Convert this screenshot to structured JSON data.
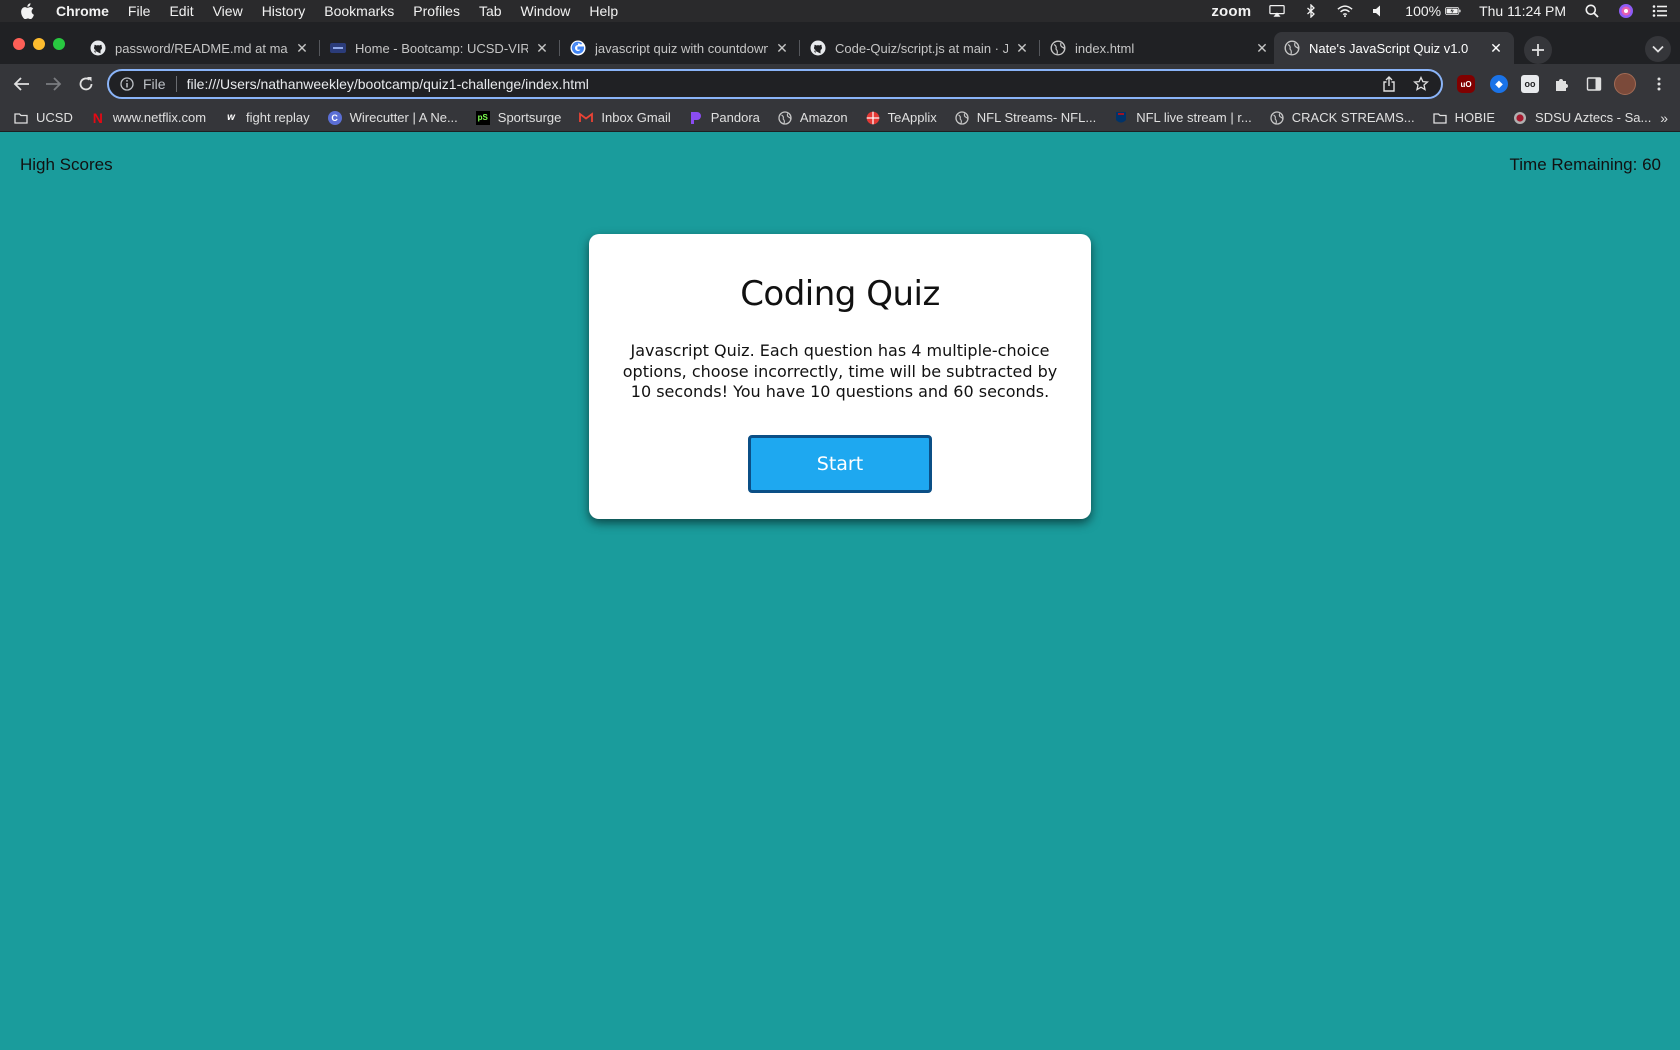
{
  "menubar": {
    "app_name": "Chrome",
    "menus": [
      "File",
      "Edit",
      "View",
      "History",
      "Bookmarks",
      "Profiles",
      "Tab",
      "Window",
      "Help"
    ],
    "zoom_label": "zoom",
    "battery": "100%",
    "clock": "Thu 11:24 PM"
  },
  "tabs": [
    {
      "title": "password/README.md at mast",
      "icon": "github-icon"
    },
    {
      "title": "Home - Bootcamp: UCSD-VIRT",
      "icon": "bootcamp-icon"
    },
    {
      "title": "javascript quiz with countdown",
      "icon": "google-icon"
    },
    {
      "title": "Code-Quiz/script.js at main · J",
      "icon": "github-icon"
    },
    {
      "title": "index.html",
      "icon": "globe-icon"
    },
    {
      "title": "Nate's JavaScript Quiz v1.0",
      "icon": "globe-icon",
      "active": true
    }
  ],
  "toolbar": {
    "scheme_label": "File",
    "url": "file:///Users/nathanweekley/bootcamp/quiz1-challenge/index.html"
  },
  "bookmarks": [
    {
      "label": "UCSD",
      "icon": "folder-icon"
    },
    {
      "label": "www.netflix.com",
      "icon": "netflix-icon"
    },
    {
      "label": "fight replay",
      "icon": "w-icon"
    },
    {
      "label": "Wirecutter | A Ne...",
      "icon": "nyt-icon"
    },
    {
      "label": "Sportsurge",
      "icon": "sportsurge-icon"
    },
    {
      "label": "Inbox Gmail",
      "icon": "gmail-icon"
    },
    {
      "label": "Pandora",
      "icon": "pandora-icon"
    },
    {
      "label": "Amazon",
      "icon": "globe-icon"
    },
    {
      "label": "TeApplix",
      "icon": "teapplix-icon"
    },
    {
      "label": "NFL Streams- NFL...",
      "icon": "globe-icon"
    },
    {
      "label": "NFL live stream | r...",
      "icon": "nfl-icon"
    },
    {
      "label": "CRACK STREAMS...",
      "icon": "globe-icon"
    },
    {
      "label": "HOBIE",
      "icon": "folder-icon"
    },
    {
      "label": "SDSU Aztecs - Sa...",
      "icon": "sdsu-icon"
    }
  ],
  "page": {
    "high_scores_label": "High Scores",
    "timer_label": "Time Remaining: 60",
    "card": {
      "title": "Coding Quiz",
      "description": "Javascript Quiz. Each question has 4 multiple-choice options, choose incorrectly, time will be subtracted by 10 seconds! You have 10 questions and 60 seconds.",
      "start_label": "Start"
    }
  },
  "colors": {
    "page_background": "#1a9c9c",
    "start_button": "#1ea8f0",
    "start_button_border": "#0b4f86",
    "omnibox_focus": "#8ab4f8"
  }
}
